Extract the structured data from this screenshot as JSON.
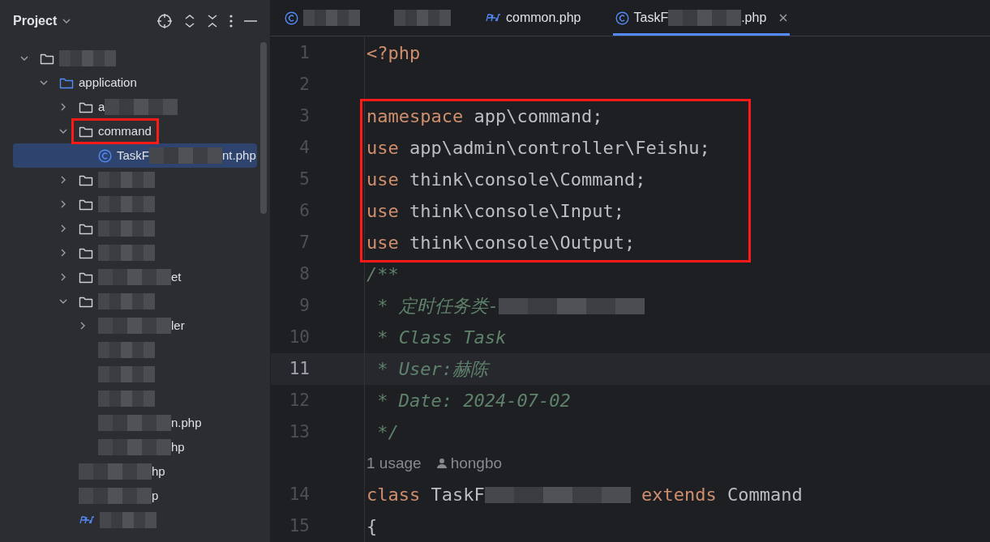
{
  "sidebar": {
    "title": "Project",
    "tree": [
      {
        "kind": "folder",
        "redacted": true,
        "expanded": true,
        "selected": false,
        "highlighted": false,
        "children": [
          {
            "label": "application",
            "kind": "source",
            "redacted": false,
            "expanded": true,
            "selected": false,
            "highlighted": false,
            "children": [
              {
                "prefix": "a",
                "kind": "folder",
                "redacted": true,
                "expanded": false,
                "selected": false,
                "highlighted": false
              },
              {
                "label": "command",
                "kind": "folder",
                "redacted": false,
                "expanded": true,
                "selected": false,
                "highlighted": true,
                "children": [
                  {
                    "prefix": "TaskF",
                    "suffix": "nt.php",
                    "kind": "class",
                    "redacted": true,
                    "selected": true,
                    "highlighted": false
                  }
                ]
              },
              {
                "kind": "folder",
                "redacted": true,
                "expanded": false,
                "selected": false,
                "highlighted": false
              },
              {
                "kind": "folder",
                "redacted": true,
                "expanded": false,
                "selected": false,
                "highlighted": false
              },
              {
                "kind": "folder",
                "redacted": true,
                "expanded": false,
                "selected": false,
                "highlighted": false
              },
              {
                "kind": "folder",
                "redacted": true,
                "expanded": false,
                "selected": false,
                "highlighted": false
              },
              {
                "suffix": "et",
                "kind": "folder",
                "redacted": true,
                "expanded": false,
                "selected": false,
                "highlighted": false
              },
              {
                "kind": "folder",
                "redacted": true,
                "expanded": true,
                "selected": false,
                "highlighted": false,
                "children": [
                  {
                    "suffix": "ler",
                    "kind": "none",
                    "redacted": true,
                    "expanded": false,
                    "selected": false,
                    "highlighted": false
                  },
                  {
                    "kind": "none",
                    "redacted": true,
                    "selected": false,
                    "highlighted": false
                  },
                  {
                    "kind": "none",
                    "redacted": true,
                    "selected": false,
                    "highlighted": false
                  },
                  {
                    "kind": "none",
                    "redacted": true,
                    "selected": false,
                    "highlighted": false
                  },
                  {
                    "suffix": "n.php",
                    "kind": "none",
                    "redacted": true,
                    "selected": false,
                    "highlighted": false
                  },
                  {
                    "suffix": "hp",
                    "kind": "none",
                    "redacted": true,
                    "selected": false,
                    "highlighted": false
                  }
                ]
              },
              {
                "suffix": "hp",
                "kind": "none",
                "redacted": true,
                "selected": false,
                "highlighted": false
              },
              {
                "suffix": "p",
                "kind": "none",
                "redacted": true,
                "selected": false,
                "highlighted": false
              },
              {
                "kind": "php",
                "redacted": true,
                "selected": false,
                "highlighted": false
              }
            ]
          }
        ]
      }
    ]
  },
  "tabs": [
    {
      "kind": "class",
      "redacted": true,
      "selected": false
    },
    {
      "kind": "none",
      "redacted": true,
      "selected": false
    },
    {
      "label": "common.php",
      "kind": "php",
      "redacted": false,
      "selected": false
    },
    {
      "prefix": "TaskF",
      "suffix": ".php",
      "kind": "class",
      "redacted": true,
      "selected": true
    }
  ],
  "code": {
    "lines": [
      {
        "number": "1",
        "current": false,
        "boxed": false,
        "tokens": [
          {
            "kind": "keyword",
            "text": "<?php"
          }
        ]
      },
      {
        "number": "2",
        "current": false,
        "boxed": false
      },
      {
        "number": "3",
        "current": false,
        "boxed": true,
        "tokens": [
          {
            "kind": "keyword",
            "text": "namespace"
          },
          {
            "kind": "plain",
            "text": " app\\command;"
          }
        ]
      },
      {
        "number": "4",
        "current": false,
        "boxed": true,
        "tokens": [
          {
            "kind": "keyword",
            "text": "use"
          },
          {
            "kind": "plain",
            "text": " app\\admin\\controller\\Feishu;"
          }
        ]
      },
      {
        "number": "5",
        "current": false,
        "boxed": true,
        "tokens": [
          {
            "kind": "keyword",
            "text": "use"
          },
          {
            "kind": "plain",
            "text": " think\\console\\Command;"
          }
        ]
      },
      {
        "number": "6",
        "current": false,
        "boxed": true,
        "tokens": [
          {
            "kind": "keyword",
            "text": "use"
          },
          {
            "kind": "plain",
            "text": " think\\console\\Input;"
          }
        ]
      },
      {
        "number": "7",
        "current": false,
        "boxed": true,
        "tokens": [
          {
            "kind": "keyword",
            "text": "use"
          },
          {
            "kind": "plain",
            "text": " think\\console\\Output;"
          }
        ]
      },
      {
        "number": "8",
        "current": false,
        "boxed": false,
        "tokens": [
          {
            "kind": "comment",
            "text": "/**"
          }
        ]
      },
      {
        "number": "9",
        "current": false,
        "boxed": false,
        "tokens": [
          {
            "kind": "comment",
            "text": " * 定时任务类-"
          },
          {
            "kind": "redaction"
          }
        ]
      },
      {
        "number": "10",
        "current": false,
        "boxed": false,
        "tokens": [
          {
            "kind": "comment",
            "text": " * Class Task"
          }
        ]
      },
      {
        "number": "11",
        "current": true,
        "boxed": false,
        "tokens": [
          {
            "kind": "comment",
            "text": " * User:赫陈"
          }
        ]
      },
      {
        "number": "12",
        "current": false,
        "boxed": false,
        "tokens": [
          {
            "kind": "comment",
            "text": " * Date: 2024-07-02"
          }
        ]
      },
      {
        "number": "13",
        "current": false,
        "boxed": false,
        "tokens": [
          {
            "kind": "comment",
            "text": " */"
          }
        ]
      },
      {
        "kind": "inlay",
        "usage": "1 usage",
        "author": "hongbo"
      },
      {
        "number": "14",
        "current": false,
        "boxed": false,
        "tokens": [
          {
            "kind": "keyword",
            "text": "class"
          },
          {
            "kind": "plain",
            "text": " TaskF"
          },
          {
            "kind": "redaction"
          },
          {
            "kind": "keyword",
            "text": " extends "
          },
          {
            "kind": "plain",
            "text": "Command"
          }
        ]
      },
      {
        "number": "15",
        "current": false,
        "boxed": false,
        "tokens": [
          {
            "kind": "plain",
            "text": "{"
          }
        ]
      }
    ]
  }
}
